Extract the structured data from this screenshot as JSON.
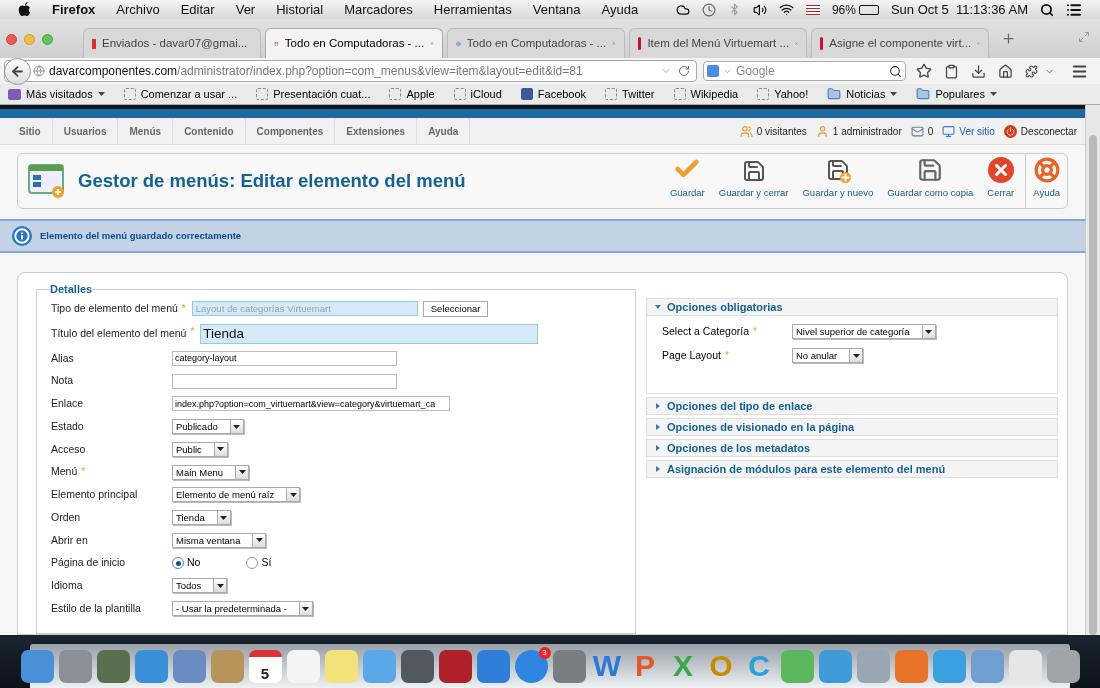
{
  "mac_menu": {
    "app": "Firefox",
    "items": [
      "Archivo",
      "Editar",
      "Ver",
      "Historial",
      "Marcadores",
      "Herramientas",
      "Ventana",
      "Ayuda"
    ],
    "battery": "96%",
    "clock": "Sun Oct 5  11:13:36 AM"
  },
  "tabs": [
    {
      "title": "Enviados - davar07@gmai...",
      "kind": "mail",
      "selected": false
    },
    {
      "title": "Todo en Computadoras - ...",
      "kind": "joomla",
      "selected": true
    },
    {
      "title": "Todo en Computadoras - ...",
      "kind": "globe",
      "selected": false
    },
    {
      "title": "Item del Menú Virtuemart ...",
      "kind": "w",
      "selected": false
    },
    {
      "title": "Asigne el componente virt...",
      "kind": "w",
      "selected": false
    }
  ],
  "url": {
    "host": "davarcomponentes.com",
    "path": "/administrator/index.php?option=com_menus&view=item&layout=edit&id=81"
  },
  "search": {
    "placeholder": "Google"
  },
  "bookmarks": [
    {
      "label": "Más visitados",
      "kind": "menu"
    },
    {
      "label": "Comenzar a usar ...",
      "kind": "page"
    },
    {
      "label": "Presentación cuat...",
      "kind": "page"
    },
    {
      "label": "Apple",
      "kind": "page"
    },
    {
      "label": "iCloud",
      "kind": "page"
    },
    {
      "label": "Facebook",
      "kind": "facebook"
    },
    {
      "label": "Twitter",
      "kind": "page"
    },
    {
      "label": "Wikipedia",
      "kind": "page"
    },
    {
      "label": "Yahoo!",
      "kind": "page"
    },
    {
      "label": "Noticias",
      "kind": "folder"
    },
    {
      "label": "Populares",
      "kind": "folder"
    }
  ],
  "admin_menu": [
    "Sitio",
    "Usuarios",
    "Menús",
    "Contenido",
    "Componentes",
    "Extensiones",
    "Ayuda"
  ],
  "status": [
    {
      "text": "0 visitantes",
      "kind": "users"
    },
    {
      "text": "1 administrador",
      "kind": "admin"
    },
    {
      "text": "0",
      "kind": "mail"
    },
    {
      "text": "Ver sitio",
      "kind": "site"
    },
    {
      "text": "Desconectar",
      "kind": "logout"
    }
  ],
  "header": {
    "title": "Gestor de menús: Editar elemento del menú"
  },
  "toolbar": [
    {
      "label": "Guardar",
      "kind": "check"
    },
    {
      "label": "Guardar y cerrar",
      "kind": "save"
    },
    {
      "label": "Guardar y nuevo",
      "kind": "save-new"
    },
    {
      "label": "Guardar como copia",
      "kind": "copy"
    },
    {
      "label": "Cerrar",
      "kind": "close"
    },
    {
      "label": "Ayuda",
      "kind": "help"
    }
  ],
  "message": "Elemento del menú guardado correctamente",
  "details": {
    "legend": "Detalles",
    "fields": [
      {
        "label": "Tipo de elemento del menú",
        "required_mark": "*",
        "kind": "readonly",
        "value": "Layout de categorías Virtuemart",
        "button": "Seleccionar"
      },
      {
        "label": "Título del elemento del menú",
        "required_mark": "*",
        "kind": "title",
        "value": "Tienda"
      },
      {
        "label": "Alias",
        "kind": "text",
        "value": "category-layout"
      },
      {
        "label": "Nota",
        "kind": "text"
      },
      {
        "label": "Enlace",
        "kind": "url",
        "value": "index.php?option=com_virtuemart&view=category&virtuemart_ca"
      },
      {
        "label": "Estado",
        "kind": "select",
        "value": "Publicado"
      },
      {
        "label": "Acceso",
        "kind": "select",
        "value": "Public"
      },
      {
        "label": "Menú",
        "required_mark": "*",
        "kind": "select",
        "value": "Main Menu"
      },
      {
        "label": "Elemento principal",
        "kind": "select",
        "value": "Elemento de menú raíz"
      },
      {
        "label": "Orden",
        "kind": "select",
        "value": "Tienda"
      },
      {
        "label": "Abrir en",
        "kind": "select",
        "value": "Misma ventana"
      },
      {
        "label": "Página de inicio",
        "kind": "radio",
        "options": [
          {
            "label": "No",
            "selected": true
          },
          {
            "label": "Sí",
            "selected": false
          }
        ]
      },
      {
        "label": "Idioma",
        "kind": "select",
        "value": "Todos"
      },
      {
        "label": "Estilo de la plantilla",
        "kind": "select",
        "value": "- Usar la predeterminada -"
      }
    ]
  },
  "options": [
    {
      "title": "Opciones obligatorias",
      "expanded": true,
      "fields": [
        {
          "label": "Select a Categoría",
          "required_mark": "*",
          "value": "Nivel superior de categoría"
        },
        {
          "label": "Page Layout",
          "required_mark": "*",
          "value": "No anular"
        }
      ]
    },
    {
      "title": "Opciones del tipo de enlace",
      "expanded": false
    },
    {
      "title": "Opciones de visionado en la página",
      "expanded": false
    },
    {
      "title": "Opciones de los metadatos",
      "expanded": false
    },
    {
      "title": "Asignación de módulos para este elemento del menú",
      "expanded": false
    }
  ],
  "dock": [
    {
      "kind": "app",
      "color": "#4a90d9"
    },
    {
      "kind": "app",
      "color": "#8a8f98"
    },
    {
      "kind": "app",
      "color": "#5a6f50"
    },
    {
      "kind": "app",
      "color": "#3a8fd8"
    },
    {
      "kind": "app",
      "color": "#6b8cc0"
    },
    {
      "kind": "app",
      "color": "#b8935a"
    },
    {
      "kind": "calendar",
      "day": "5",
      "color": "#ffffff"
    },
    {
      "kind": "app",
      "color": "#f4f4f4"
    },
    {
      "kind": "app",
      "color": "#f2e27a"
    },
    {
      "kind": "app",
      "color": "#5aa8e8"
    },
    {
      "kind": "app",
      "color": "#505860"
    },
    {
      "kind": "app",
      "color": "#b0202a"
    },
    {
      "kind": "app",
      "color": "#2f7ed8"
    },
    {
      "kind": "badge",
      "badge": "3",
      "color": "#2f86e0"
    },
    {
      "kind": "app",
      "color": "#7a7d82"
    },
    {
      "kind": "letter",
      "glyph": "W",
      "color": "#2b7bd6"
    },
    {
      "kind": "letter",
      "glyph": "P",
      "color": "#e2582a"
    },
    {
      "kind": "letter",
      "glyph": "X",
      "color": "#3aa845"
    },
    {
      "kind": "letter",
      "glyph": "O",
      "color": "#c98a00"
    },
    {
      "kind": "letter",
      "glyph": "C",
      "color": "#2ba0d8"
    },
    {
      "kind": "app",
      "color": "#5cb85c"
    },
    {
      "kind": "app",
      "color": "#3f9ad8"
    },
    {
      "kind": "app",
      "color": "#9aa6b2"
    },
    {
      "kind": "app",
      "color": "#e8742a"
    },
    {
      "kind": "app",
      "color": "#3aa0e0"
    },
    {
      "kind": "app",
      "color": "#6f9fd0"
    },
    {
      "kind": "app",
      "color": "#e6e6e6"
    },
    {
      "kind": "app",
      "color": "#a0a4a8"
    }
  ]
}
